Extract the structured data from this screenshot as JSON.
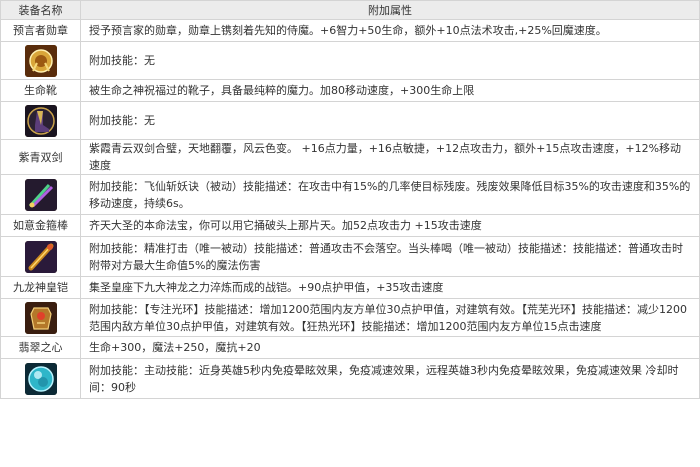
{
  "table": {
    "headers": [
      "装备名称",
      "附加属性"
    ],
    "rows": [
      {
        "name": "预言者勋章",
        "attr": "授予预言家的勋章，勋章上镌刻着先知的侍魔。+6智力+50生命，额外+10点法术攻击,+25%回魔速度。",
        "icon": "medal-icon",
        "skill": "附加技能：无"
      },
      {
        "name": "生命靴",
        "attr": "被生命之神祝福过的靴子，具备最纯粹的魔力。加80移动速度，+300生命上限",
        "icon": "boots-icon",
        "skill": "附加技能：无"
      },
      {
        "name": "紫青双剑",
        "attr": "紫霞青云双剑合璧，天地翻覆，风云色变。 +16点力量，+16点敏捷，+12点攻击力，额外+15点攻击速度，+12%移动速度",
        "icon": "twin-swords-icon",
        "skill": "附加技能：飞仙斩妖诀（被动）技能描述：在攻击中有15%的几率使目标残废。残废效果降低目标35%的攻击速度和35%的移动速度，持续6s。"
      },
      {
        "name": "如意金箍棒",
        "attr": "齐天大圣的本命法宝，你可以用它捅破头上那片天。加52点攻击力 +15攻击速度",
        "icon": "golden-staff-icon",
        "skill": "附加技能：精准打击（唯一被动）技能描述：普通攻击不会落空。当头棒喝（唯一被动）技能描述：技能描述：普通攻击时附带对方最大生命值5%的魔法伤害"
      },
      {
        "name": "九龙神皇铠",
        "attr": "集圣皇座下九大神龙之力淬炼而成的战铠。+90点护甲值，+35攻击速度",
        "icon": "armor-icon",
        "skill": "附加技能：【专注光环】技能描述：增加1200范围内友方单位30点护甲值，对建筑有效。【荒芜光环】技能描述：减少1200范围内敌方单位30点护甲值，对建筑有效。【狂热光环】技能描述：增加1200范围内友方单位15点击速度"
      },
      {
        "name": "翡翠之心",
        "attr": "生命+300，魔法+250，魔抗+20",
        "icon": "emerald-heart-icon",
        "skill": "附加技能：主动技能：近身英雄5秒内免疫晕眩效果，免疫减速效果，远程英雄3秒内免疫晕眩效果，免疫减速效果 冷却时间：90秒"
      }
    ]
  },
  "colors": {
    "header_bg": "#ececec",
    "border": "#d4d4d4",
    "text": "#333333"
  }
}
